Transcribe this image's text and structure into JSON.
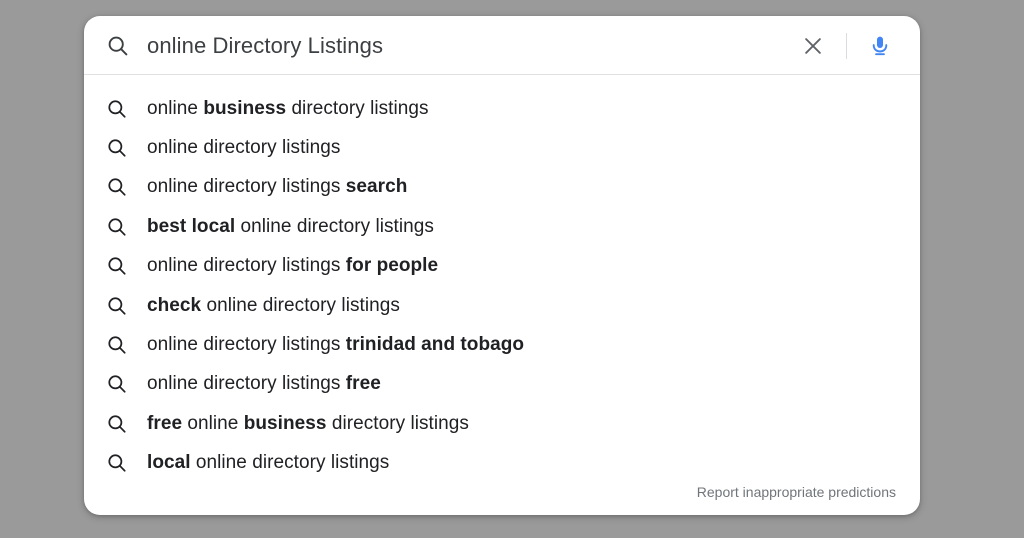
{
  "colors": {
    "page_background": "#9a9a9a",
    "card_background": "#ffffff",
    "query_text": "#3c4043",
    "suggestion_text": "#202124",
    "footer_text": "#70757a",
    "divider": "#dfe1e5",
    "mic_blue": "#4285f4",
    "clear_icon": "#5f6368"
  },
  "search": {
    "icon": "search-icon",
    "value": "online Directory Listings",
    "placeholder": "Search",
    "clear_icon": "close-icon",
    "voice_icon": "microphone-icon"
  },
  "suggestions": [
    {
      "icon": "search-icon",
      "parts": [
        {
          "text": "online ",
          "bold": false
        },
        {
          "text": "business",
          "bold": true
        },
        {
          "text": " directory listings",
          "bold": false
        }
      ],
      "plain": "online business directory listings"
    },
    {
      "icon": "search-icon",
      "parts": [
        {
          "text": "online directory listings",
          "bold": false
        }
      ],
      "plain": "online directory listings"
    },
    {
      "icon": "search-icon",
      "parts": [
        {
          "text": "online directory listings ",
          "bold": false
        },
        {
          "text": "search",
          "bold": true
        }
      ],
      "plain": "online directory listings search"
    },
    {
      "icon": "search-icon",
      "parts": [
        {
          "text": "best local",
          "bold": true
        },
        {
          "text": " online directory listings",
          "bold": false
        }
      ],
      "plain": "best local online directory listings"
    },
    {
      "icon": "search-icon",
      "parts": [
        {
          "text": "online directory listings ",
          "bold": false
        },
        {
          "text": "for people",
          "bold": true
        }
      ],
      "plain": "online directory listings for people"
    },
    {
      "icon": "search-icon",
      "parts": [
        {
          "text": "check",
          "bold": true
        },
        {
          "text": " online directory listings",
          "bold": false
        }
      ],
      "plain": "check online directory listings"
    },
    {
      "icon": "search-icon",
      "parts": [
        {
          "text": "online directory listings ",
          "bold": false
        },
        {
          "text": "trinidad and tobago",
          "bold": true
        }
      ],
      "plain": "online directory listings trinidad and tobago"
    },
    {
      "icon": "search-icon",
      "parts": [
        {
          "text": "online directory listings ",
          "bold": false
        },
        {
          "text": "free",
          "bold": true
        }
      ],
      "plain": "online directory listings free"
    },
    {
      "icon": "search-icon",
      "parts": [
        {
          "text": "free",
          "bold": true
        },
        {
          "text": " online ",
          "bold": false
        },
        {
          "text": "business",
          "bold": true
        },
        {
          "text": " directory listings",
          "bold": false
        }
      ],
      "plain": "free online business directory listings"
    },
    {
      "icon": "search-icon",
      "parts": [
        {
          "text": "local",
          "bold": true
        },
        {
          "text": " online directory listings",
          "bold": false
        }
      ],
      "plain": "local online directory listings"
    }
  ],
  "footer": {
    "report_label": "Report inappropriate predictions"
  }
}
